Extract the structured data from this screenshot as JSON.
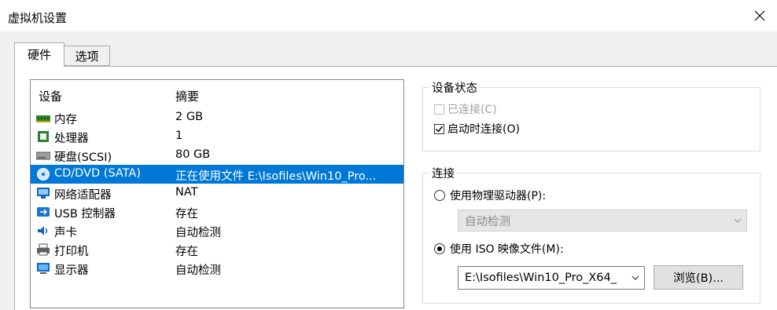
{
  "window": {
    "title": "虚拟机设置"
  },
  "tabs": [
    {
      "label": "硬件",
      "active": true
    },
    {
      "label": "选项",
      "active": false
    }
  ],
  "device_list": {
    "columns": [
      "设备",
      "摘要"
    ],
    "rows": [
      {
        "name": "内存",
        "summary": "2 GB",
        "icon": "memory-icon"
      },
      {
        "name": "处理器",
        "summary": "1",
        "icon": "processor-icon"
      },
      {
        "name": "硬盘(SCSI)",
        "summary": "80 GB",
        "icon": "hard-disk-icon"
      },
      {
        "name": "CD/DVD (SATA)",
        "summary": "正在使用文件 E:\\Isofiles\\Win10_Pro...",
        "icon": "cd-dvd-icon",
        "selected": true
      },
      {
        "name": "网络适配器",
        "summary": "NAT",
        "icon": "network-adapter-icon"
      },
      {
        "name": "USB 控制器",
        "summary": "存在",
        "icon": "usb-controller-icon"
      },
      {
        "name": "声卡",
        "summary": "自动检测",
        "icon": "sound-card-icon"
      },
      {
        "name": "打印机",
        "summary": "存在",
        "icon": "printer-icon"
      },
      {
        "name": "显示器",
        "summary": "自动检测",
        "icon": "display-icon"
      }
    ]
  },
  "device_status": {
    "title": "设备状态",
    "connected_label": "已连接(C)",
    "connected_checked": false,
    "connected_enabled": false,
    "connect_at_power_on_label": "启动时连接(O)",
    "connect_at_power_on_checked": true
  },
  "connection": {
    "title": "连接",
    "physical_drive_label": "使用物理驱动器(P):",
    "physical_drive_selected": false,
    "physical_drive_value": "自动检测",
    "iso_label": "使用 ISO 映像文件(M):",
    "iso_selected": true,
    "iso_value": "E:\\Isofiles\\Win10_Pro_X64_",
    "browse_label": "浏览(B)..."
  },
  "colors": {
    "selection": "#0078d7",
    "background": "#f0f0f0"
  }
}
